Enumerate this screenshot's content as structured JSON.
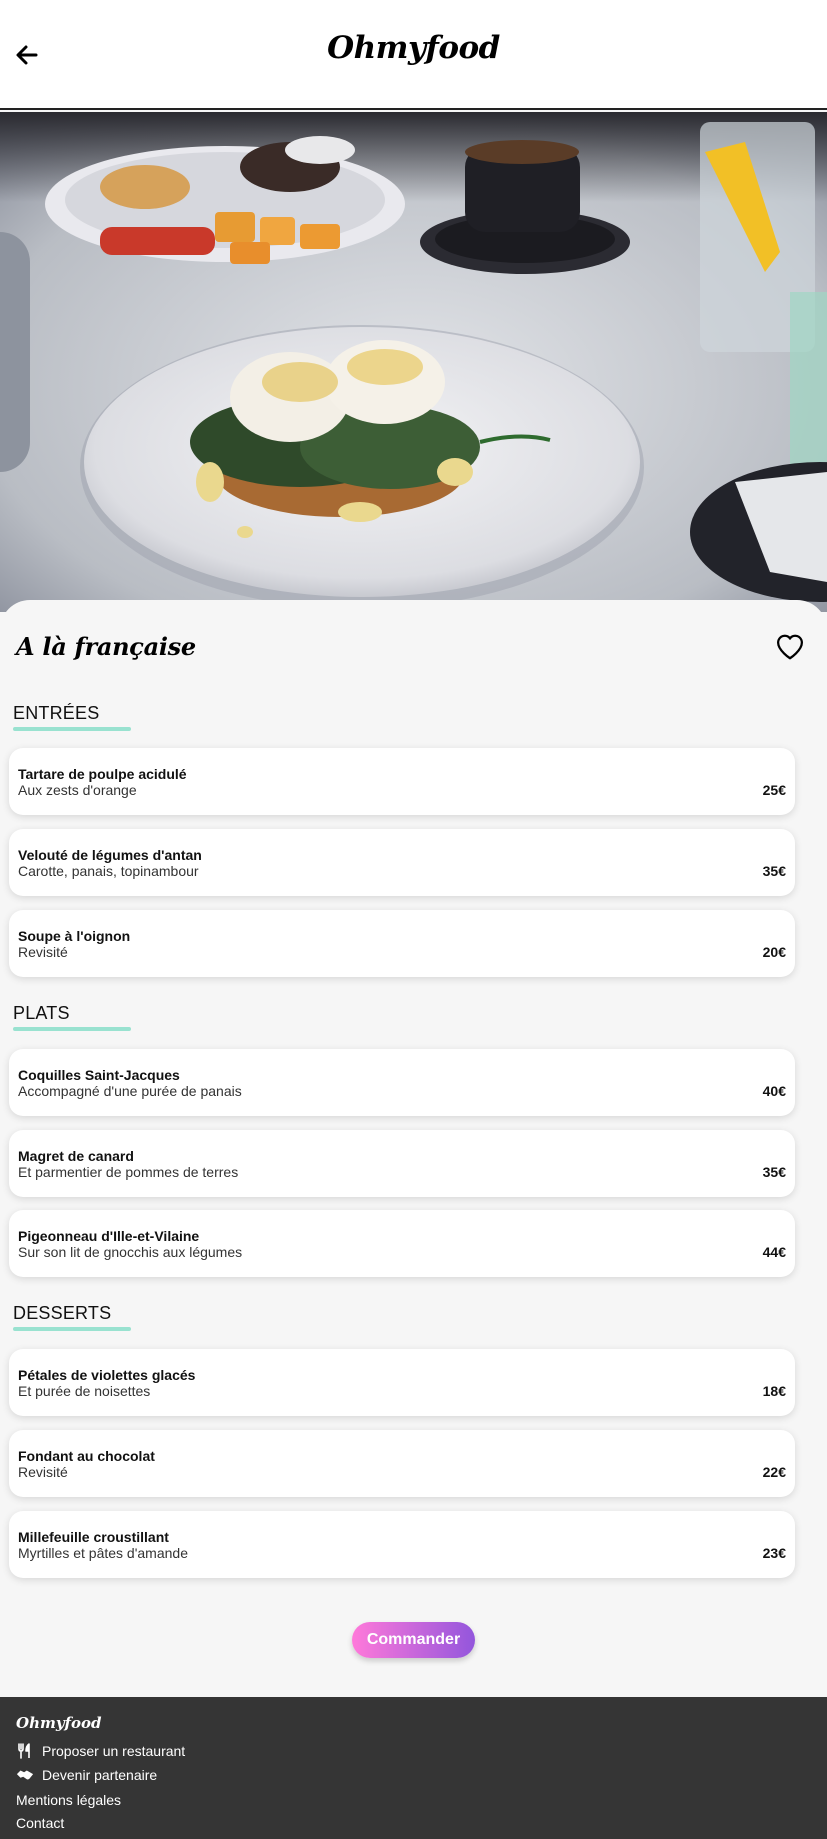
{
  "header": {
    "brand": "Ohmyfood",
    "back_icon": "arrow-left-icon"
  },
  "hero": {
    "image": "eggs-benedict-photo"
  },
  "restaurant": {
    "title": "A là française",
    "favorite_icon": "heart-outline-icon"
  },
  "sections": [
    {
      "label": "ENTRÉES",
      "items": [
        {
          "name": "Tartare de poulpe acidulé",
          "description": "Aux zests d'orange",
          "price": "25€"
        },
        {
          "name": "Velouté de légumes d'antan",
          "description": "Carotte, panais, topinambour",
          "price": "35€"
        },
        {
          "name": "Soupe à l'oignon",
          "description": "Revisité",
          "price": "20€"
        }
      ]
    },
    {
      "label": "PLATS",
      "items": [
        {
          "name": "Coquilles Saint-Jacques",
          "description": "Accompagné d'une purée de panais",
          "price": "40€"
        },
        {
          "name": "Magret de canard",
          "description": "Et parmentier de pommes de terres",
          "price": "35€"
        },
        {
          "name": "Pigeonneau d'Ille-et-Vilaine",
          "description": "Sur son lit de gnocchis aux légumes",
          "price": "44€"
        }
      ]
    },
    {
      "label": "DESSERTS",
      "items": [
        {
          "name": "Pétales de violettes glacés",
          "description": "Et purée de noisettes",
          "price": "18€"
        },
        {
          "name": "Fondant au chocolat",
          "description": "Revisité",
          "price": "22€"
        },
        {
          "name": "Millefeuille croustillant",
          "description": "Myrtilles et pâtes d'amande",
          "price": "23€"
        }
      ]
    }
  ],
  "order_button": "Commander",
  "footer": {
    "brand": "Ohmyfood",
    "links": [
      {
        "label": "Proposer un restaurant",
        "icon": "utensils-icon"
      },
      {
        "label": "Devenir partenaire",
        "icon": "handshake-icon"
      },
      {
        "label": "Mentions légales",
        "icon": ""
      },
      {
        "label": "Contact",
        "icon": ""
      }
    ]
  },
  "colors": {
    "accent_underline": "#99e2d0",
    "button_gradient_start": "#ff79da",
    "button_gradient_end": "#9356dc",
    "footer_bg": "#353535",
    "page_bg": "#f6f6f6"
  }
}
